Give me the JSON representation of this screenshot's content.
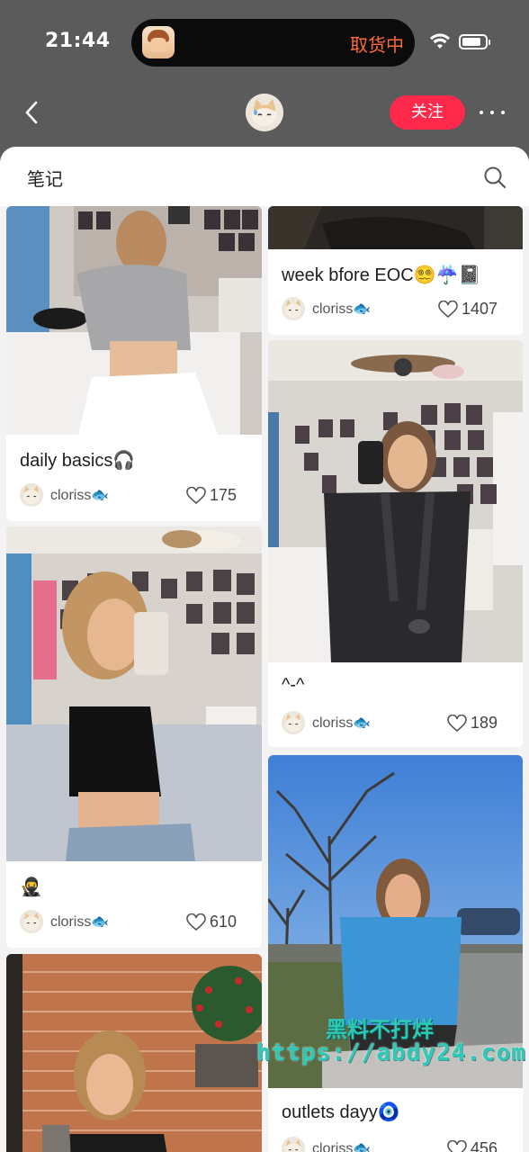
{
  "status_bar": {
    "time": "21:44",
    "live_activity_text": "取货中",
    "live_activity_color": "#ff6a3a"
  },
  "nav": {
    "follow_label": "关注",
    "back_icon": "chevron-left-icon",
    "more_icon": "more-horizontal-icon"
  },
  "section": {
    "title": "笔记",
    "search_icon": "search-icon"
  },
  "notes": [
    {
      "title": "daily basics🎧",
      "author": "cloriss🐟",
      "likes": "175"
    },
    {
      "title": "week bfore EOC😵‍💫☔️📓",
      "author": "cloriss🐟",
      "likes": "1407"
    },
    {
      "title": "🥷",
      "author": "cloriss🐟",
      "likes": "610"
    },
    {
      "title": "^-^",
      "author": "cloriss🐟",
      "likes": "189"
    },
    {
      "title": "outlets dayy🧿",
      "author": "cloriss🐟",
      "likes": "456"
    }
  ],
  "watermark": {
    "text_cn": "黑料不打烊",
    "text_url": "https://abdy24.com"
  },
  "colors": {
    "accent": "#ff2a4b",
    "sheet_bg": "#f3f3f3",
    "header_bg": "#5b5b5b"
  }
}
